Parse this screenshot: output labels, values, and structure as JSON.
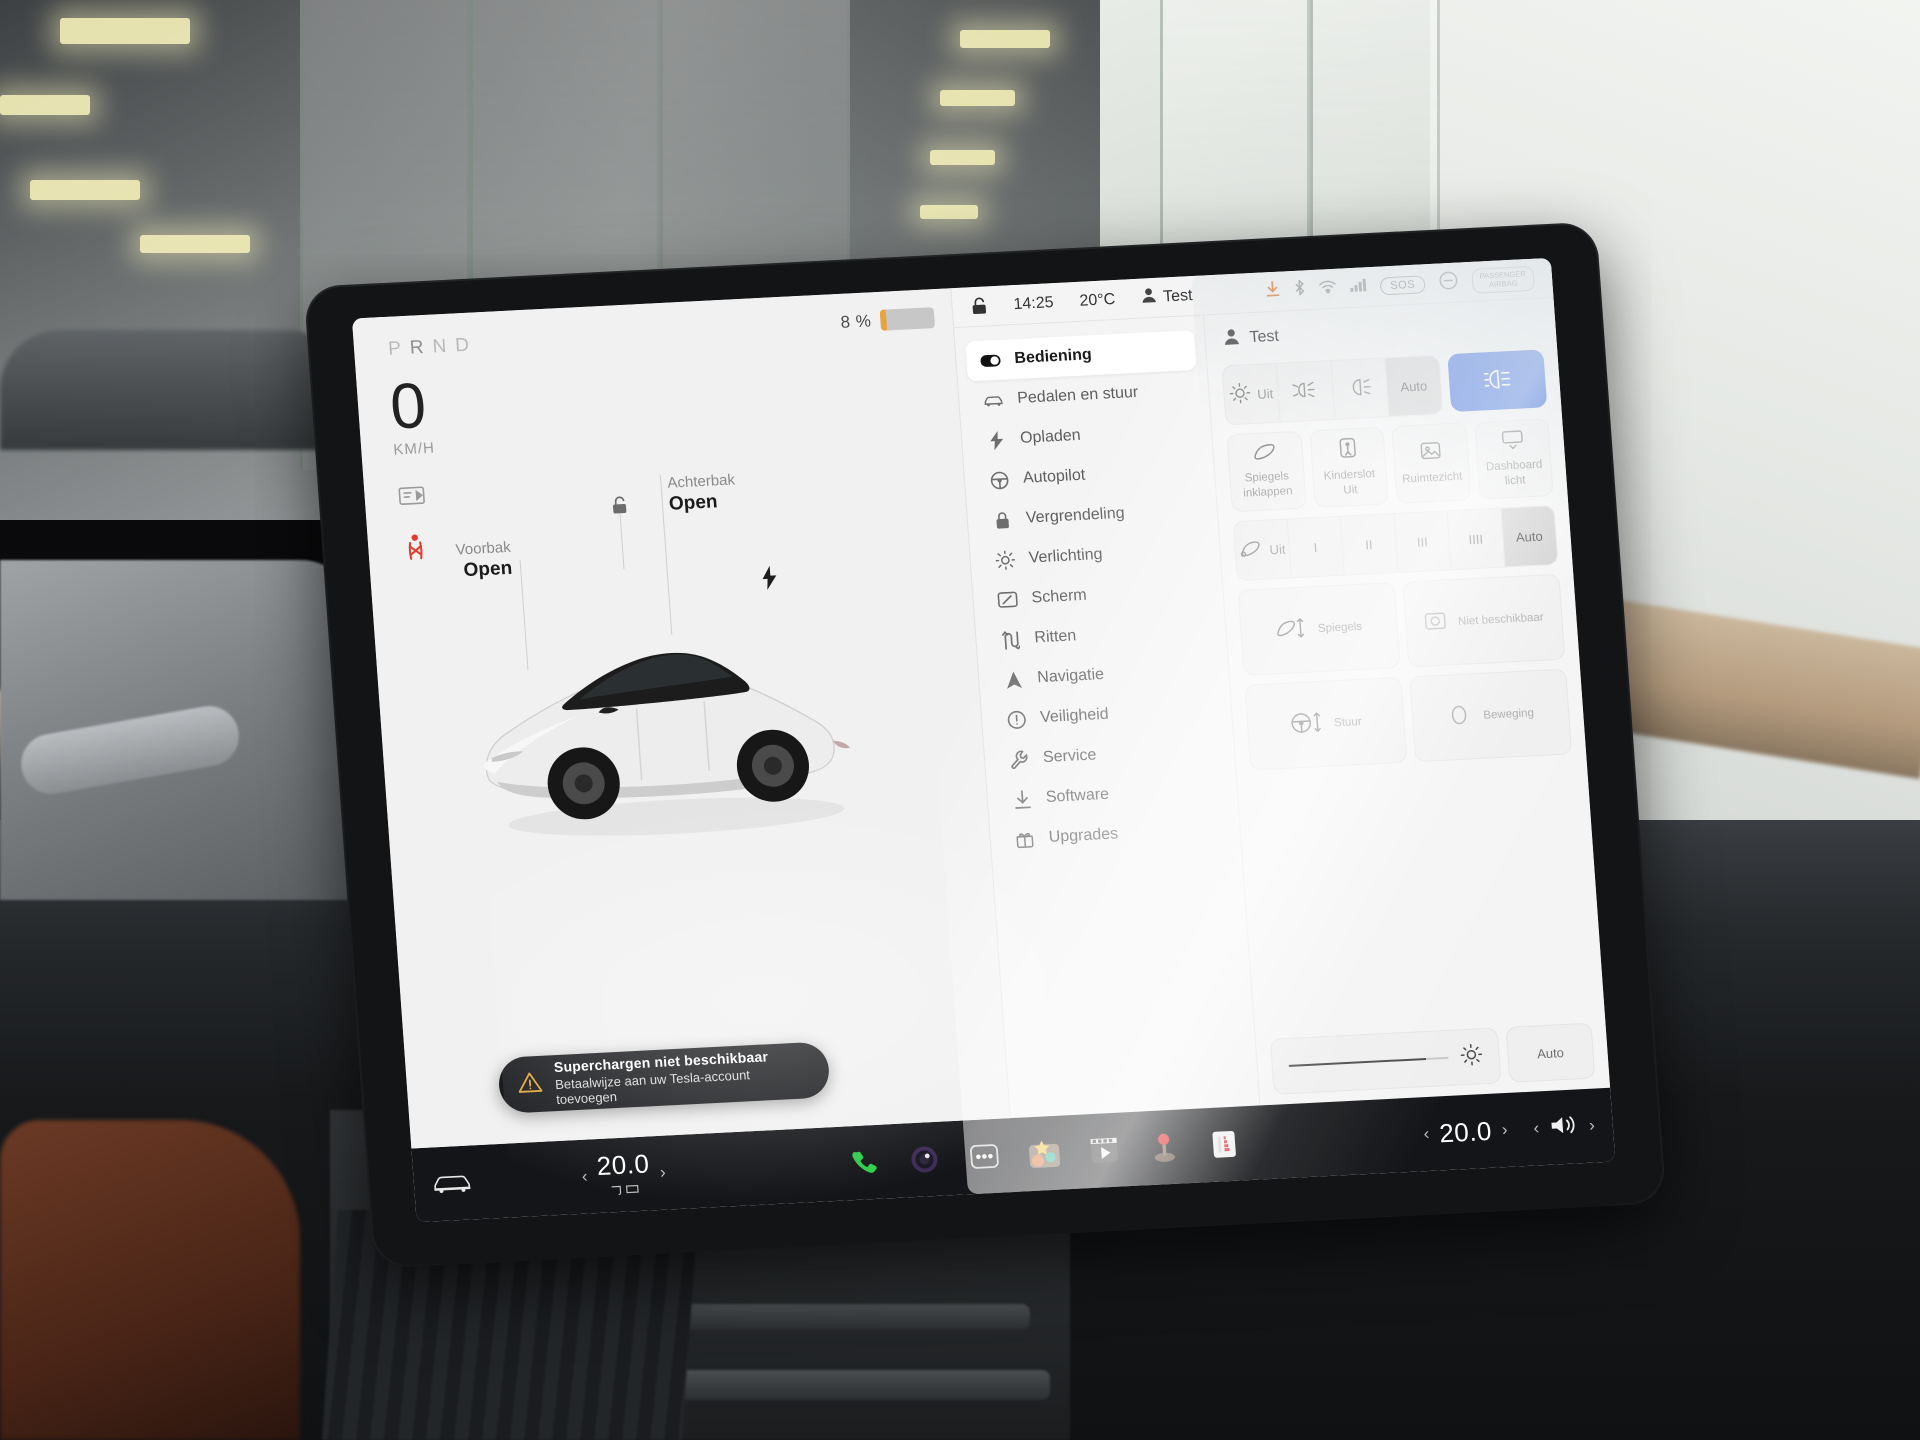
{
  "driver": {
    "gear_letters": [
      "P",
      "R",
      "N",
      "D"
    ],
    "gear_active": "R",
    "speed_value": "0",
    "speed_unit": "KM/H",
    "battery_percent": "8 %",
    "battery_level": 8,
    "front_trunk": {
      "label": "Voorbak",
      "state": "Open"
    },
    "rear_trunk": {
      "label": "Achterbak",
      "state": "Open"
    },
    "toast": {
      "title": "Superchargen niet beschikbaar",
      "subtitle": "Betaalwijze aan uw Tesla-account toevoegen",
      "icon": "warning-triangle-icon",
      "accent": "#e0a33a"
    },
    "icons": [
      "media-card-icon",
      "seatbelt-warning-icon"
    ]
  },
  "status_bar": {
    "lock_icon": "unlock-icon",
    "time": "14:25",
    "temperature": "20°C",
    "profile_icon": "person-icon",
    "profile_name": "Test",
    "right_icons": [
      "download-arrow-icon",
      "bluetooth-icon",
      "wifi-icon",
      "signal-icon"
    ],
    "sos_label": "SOS",
    "passenger_airbag_label": "PASSENGER\nAIRBAG",
    "airbag_state_icon": "airbag-off-icon"
  },
  "settings": {
    "menu": [
      {
        "label": "Bediening",
        "icon": "toggle-icon",
        "selected": true
      },
      {
        "label": "Pedalen en stuur",
        "icon": "car-icon",
        "selected": false
      },
      {
        "label": "Opladen",
        "icon": "bolt-icon",
        "selected": false
      },
      {
        "label": "Autopilot",
        "icon": "steering-wheel-icon",
        "selected": false
      },
      {
        "label": "Vergrendeling",
        "icon": "lock-icon",
        "selected": false
      },
      {
        "label": "Verlichting",
        "icon": "sun-icon",
        "selected": false
      },
      {
        "label": "Scherm",
        "icon": "display-icon",
        "selected": false
      },
      {
        "label": "Ritten",
        "icon": "route-icon",
        "selected": false
      },
      {
        "label": "Navigatie",
        "icon": "navigation-arrow-icon",
        "selected": false
      },
      {
        "label": "Veiligheid",
        "icon": "alert-circle-icon",
        "selected": false
      },
      {
        "label": "Service",
        "icon": "wrench-icon",
        "selected": false
      },
      {
        "label": "Software",
        "icon": "download-icon",
        "selected": false
      },
      {
        "label": "Upgrades",
        "icon": "gift-icon",
        "selected": false
      }
    ],
    "profile": {
      "icon": "person-icon",
      "name": "Test"
    },
    "lights_row": [
      {
        "label": "Uit",
        "icon": "light-off-icon",
        "state": "off"
      },
      {
        "label": "",
        "icon": "fog-light-icon",
        "state": "off"
      },
      {
        "label": "",
        "icon": "low-beam-icon",
        "state": "off"
      },
      {
        "label": "Auto",
        "icon": "",
        "state": "on"
      }
    ],
    "high_beam": {
      "label": "",
      "icon": "high-beam-icon",
      "state": "active",
      "color": "#1a56db"
    },
    "tiles_row_1": [
      {
        "label": "Spiegels inklappen",
        "icon": "mirror-fold-icon"
      },
      {
        "label": "Kinderslot Uit",
        "icon": "child-lock-icon"
      },
      {
        "label": "Ruimtezicht",
        "icon": "glovebox-icon"
      },
      {
        "label": "Dashboard licht",
        "icon": "dashcam-icon"
      }
    ],
    "wipers_row": [
      {
        "label": "Uit",
        "icon": "wiper-icon",
        "state": "off"
      },
      {
        "label": "I",
        "icon": "",
        "state": "off"
      },
      {
        "label": "II",
        "icon": "",
        "state": "off"
      },
      {
        "label": "III",
        "icon": "",
        "state": "off"
      },
      {
        "label": "IIII",
        "icon": "",
        "state": "off"
      },
      {
        "label": "Auto",
        "icon": "",
        "state": "on"
      }
    ],
    "tiles_row_2": [
      {
        "label": "Spiegels",
        "icon": "mirror-adjust-icon"
      },
      {
        "label": "Niet beschikbaar",
        "icon": "camera-icon"
      }
    ],
    "tiles_row_3": [
      {
        "label": "Stuur",
        "icon": "steering-adjust-icon"
      },
      {
        "label": "Beweging",
        "icon": "motion-icon"
      }
    ],
    "brightness": {
      "icon": "brightness-icon",
      "value": 86,
      "auto_label": "Auto"
    }
  },
  "dock": {
    "car_icon": "car-front-icon",
    "climate_left": {
      "value": "20.0",
      "prev_icon": "chevron-left-icon",
      "next_icon": "chevron-right-icon",
      "sub_icon": "defrost-icon"
    },
    "apps": [
      {
        "name": "phone-icon"
      },
      {
        "name": "camera-icon"
      },
      {
        "name": "more-dots-icon"
      },
      {
        "name": "toybox-icon"
      },
      {
        "name": "video-player-icon"
      },
      {
        "name": "arcade-joystick-icon"
      },
      {
        "name": "theater-icon"
      }
    ],
    "climate_right": {
      "value": "20.0",
      "prev_icon": "chevron-left-icon",
      "next_icon": "chevron-right-icon"
    },
    "volume": {
      "icon": "volume-icon",
      "prev_icon": "chevron-left-icon",
      "next_icon": "chevron-right-icon"
    }
  },
  "colors": {
    "accent_blue": "#1a56db",
    "battery_orange": "#e8a33d",
    "warn_amber": "#e0a33a",
    "alert_red": "#e03b2f"
  }
}
